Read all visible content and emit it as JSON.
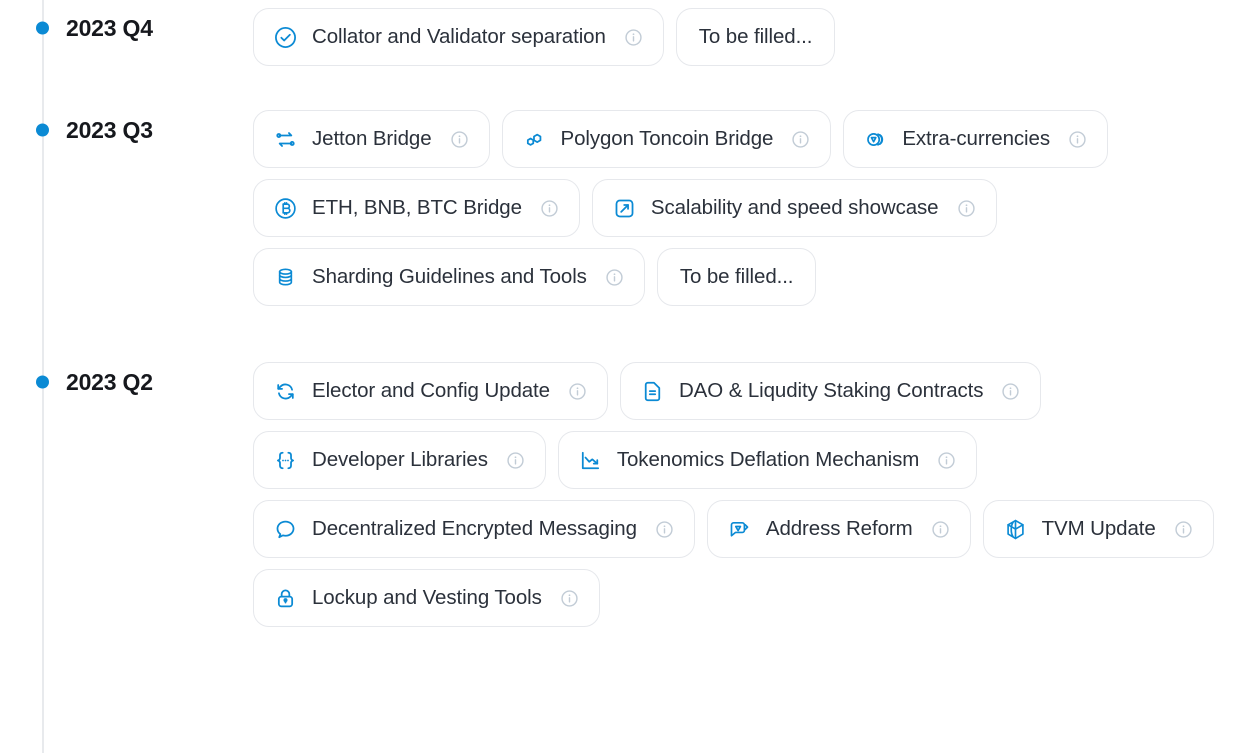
{
  "theme": {
    "accent": "#0b8ad4",
    "text": "#2b313b",
    "label_text": "#16181d",
    "chip_border": "#e6e8ec",
    "rail": "#e8eaed",
    "info_icon": "#c2ccd6",
    "background": "#ffffff"
  },
  "timeline": {
    "quarters": [
      {
        "label": "2023 Q4",
        "items": [
          {
            "label": "Collator and Validator separation",
            "icon": "check-circle-icon",
            "has_info": true
          },
          {
            "label": "To be filled...",
            "icon": null,
            "has_info": false
          }
        ]
      },
      {
        "label": "2023 Q3",
        "items": [
          {
            "label": "Jetton Bridge",
            "icon": "bridge-swap-icon",
            "has_info": true
          },
          {
            "label": "Polygon Toncoin Bridge",
            "icon": "polygon-chain-icon",
            "has_info": true
          },
          {
            "label": "Extra-currencies",
            "icon": "coins-icon",
            "has_info": true
          },
          {
            "label": "ETH, BNB, BTC Bridge",
            "icon": "bitcoin-circle-icon",
            "has_info": true
          },
          {
            "label": "Scalability and speed showcase",
            "icon": "expand-arrow-box-icon",
            "has_info": true
          },
          {
            "label": "Sharding Guidelines and Tools",
            "icon": "database-stack-icon",
            "has_info": true
          },
          {
            "label": "To be filled...",
            "icon": null,
            "has_info": false
          }
        ]
      },
      {
        "label": "2023 Q2",
        "items": [
          {
            "label": "Elector and Config Update",
            "icon": "refresh-sync-icon",
            "has_info": true
          },
          {
            "label": "DAO & Liqudity Staking Contracts",
            "icon": "document-icon",
            "has_info": true
          },
          {
            "label": "Developer Libraries",
            "icon": "code-braces-icon",
            "has_info": true
          },
          {
            "label": "Tokenomics Deflation Mechanism",
            "icon": "trend-down-chart-icon",
            "has_info": true
          },
          {
            "label": "Decentralized Encrypted Messaging",
            "icon": "chat-bubble-icon",
            "has_info": true
          },
          {
            "label": "Address Reform",
            "icon": "ton-tag-icon",
            "has_info": true
          },
          {
            "label": "TVM Update",
            "icon": "cube-3d-icon",
            "has_info": true
          },
          {
            "label": "Lockup and Vesting Tools",
            "icon": "lock-icon",
            "has_info": true
          }
        ]
      }
    ]
  }
}
